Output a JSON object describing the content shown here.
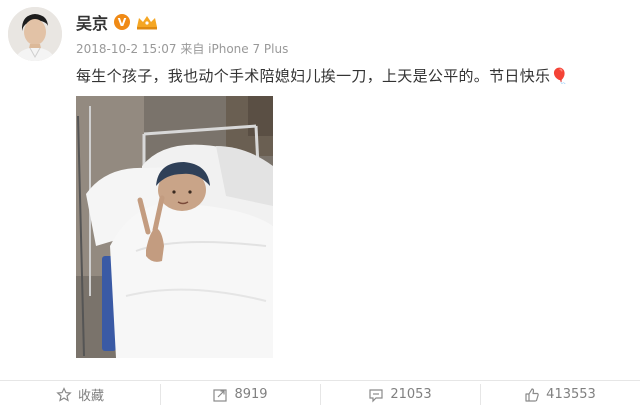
{
  "post": {
    "author": "吴京",
    "timestamp": "2018-10-2 15:07",
    "source": "来自 iPhone 7 Plus",
    "text": "每生个孩子，我也动个手术陪媳妇儿挨一刀，上天是公平的。节日快乐🎈"
  },
  "badges": {
    "verified": "V",
    "verified_color": "#f08a15"
  },
  "actions": {
    "favorite_label": "收藏",
    "repost_count": "8919",
    "comment_count": "21053",
    "like_count": "413553"
  },
  "icons": {
    "verified": "verified-v-icon",
    "vip": "vip-crown-icon",
    "favorite": "star-icon",
    "repost": "repost-icon",
    "comment": "comment-icon",
    "like": "thumbs-up-icon"
  }
}
